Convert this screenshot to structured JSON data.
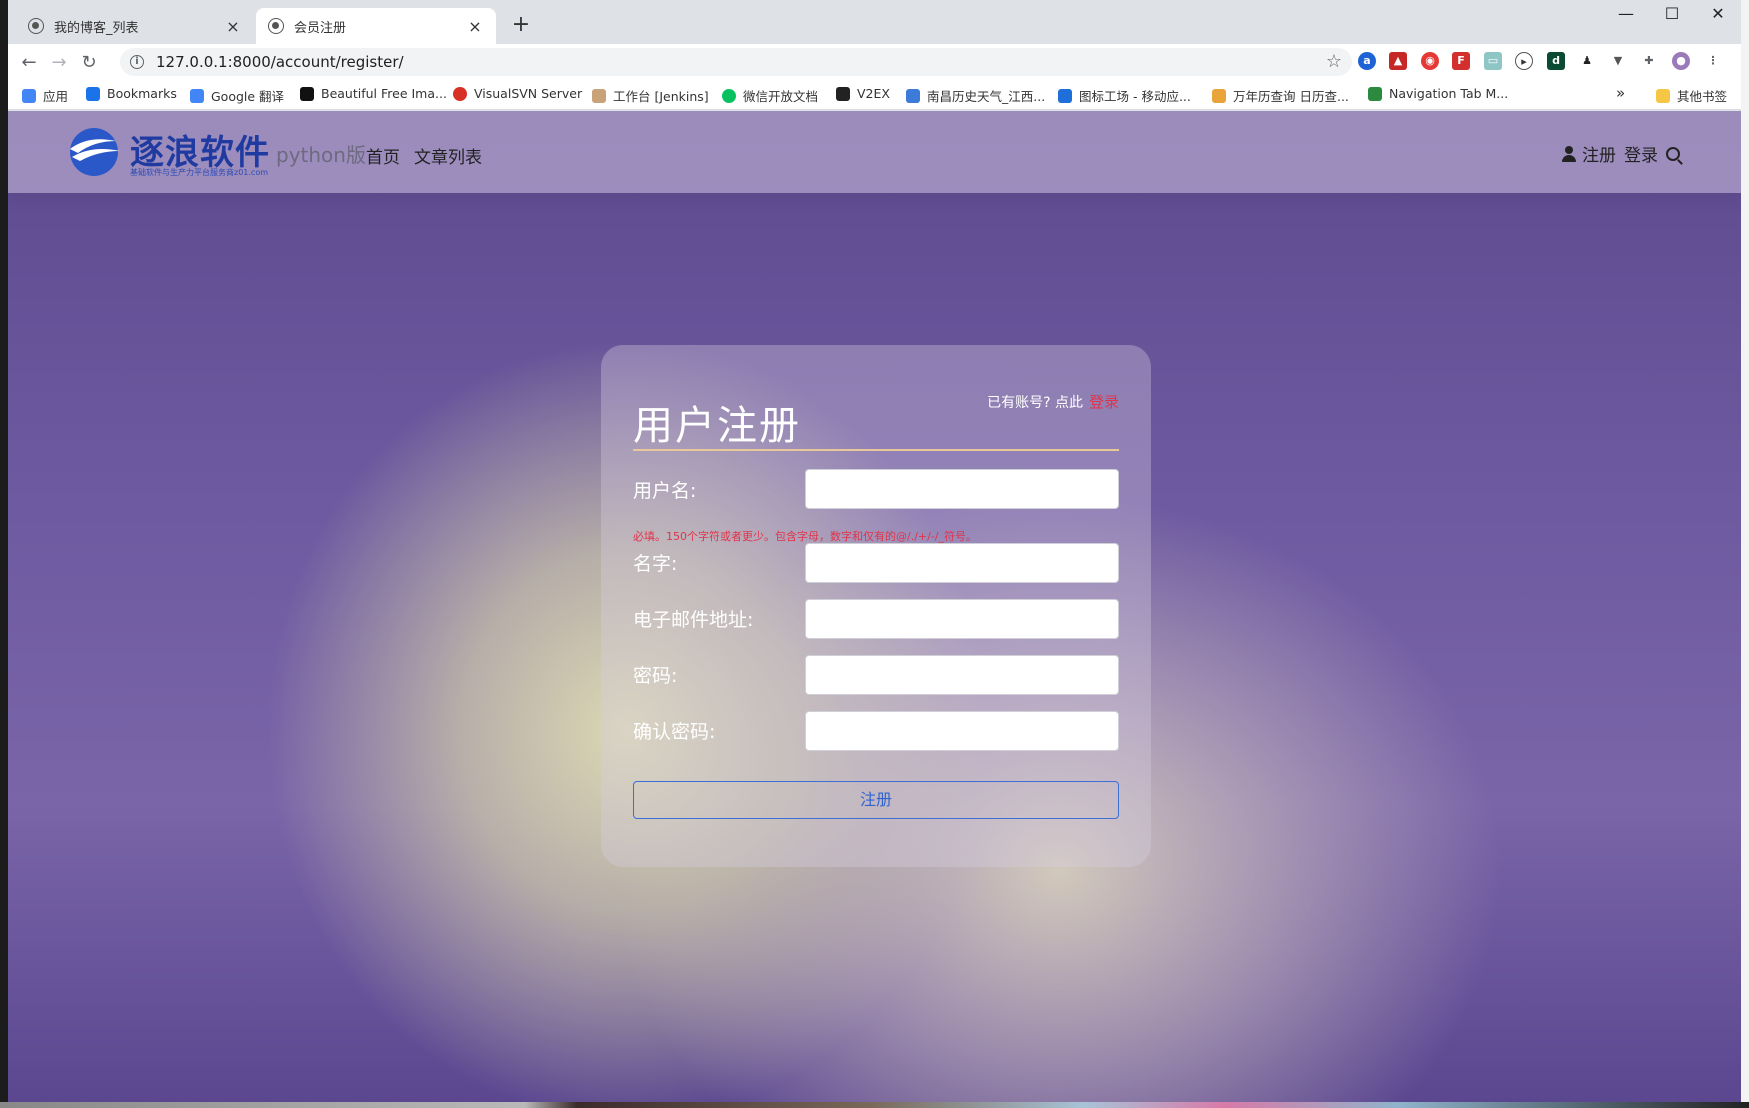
{
  "browser": {
    "tabs": [
      {
        "title": "我的博客_列表",
        "active": false
      },
      {
        "title": "会员注册",
        "active": true
      }
    ],
    "new_tab_symbol": "+",
    "close_symbol": "×",
    "window_controls": {
      "minimize": "—",
      "maximize": "☐",
      "close": "✕"
    },
    "url": "127.0.0.1:8000/account/register/",
    "bookmarks": [
      {
        "label": "应用",
        "icon": "apps-grid-icon",
        "color": "#4285f4"
      },
      {
        "label": "Bookmarks",
        "icon": "star-icon",
        "color": "#1a73e8"
      },
      {
        "label": "Google 翻译",
        "icon": "translate-icon",
        "color": "#4285f4"
      },
      {
        "label": "Beautiful Free Ima...",
        "icon": "camera-icon",
        "color": "#111111"
      },
      {
        "label": "VisualSVN Server",
        "icon": "svn-icon",
        "color": "#d93025"
      },
      {
        "label": "工作台 [Jenkins]",
        "icon": "jenkins-icon",
        "color": "#c9a27a"
      },
      {
        "label": "微信开放文档",
        "icon": "wechat-icon",
        "color": "#07c160"
      },
      {
        "label": "V2EX",
        "icon": "v2ex-icon",
        "color": "#222222"
      },
      {
        "label": "南昌历史天气_江西...",
        "icon": "weather-icon",
        "color": "#3d7bd8"
      },
      {
        "label": "图标工场 - 移动应...",
        "icon": "rh-icon",
        "color": "#1e6fd9"
      },
      {
        "label": "万年历查询 日历查...",
        "icon": "calendar-icon",
        "color": "#e8a33a"
      },
      {
        "label": "Navigation Tab M...",
        "icon": "flag-icon",
        "color": "#2b8a3e"
      }
    ],
    "bookmarks_overflow": "»",
    "other_bookmarks": "其他书签"
  },
  "site": {
    "brand": "逐浪软件",
    "slogan": "基础软件与生产力平台服务商z01.com",
    "edition": "python版",
    "nav": {
      "home": "首页",
      "articles": "文章列表"
    },
    "header_right": {
      "register": "注册",
      "login": "登录"
    },
    "colors": {
      "brand": "#1f3aa0",
      "accent_red": "#e0344b",
      "button_blue": "#2f63d0"
    }
  },
  "form": {
    "title": "用户注册",
    "login_hint": "已有账号? 点此",
    "login_link": "登录",
    "fields": [
      {
        "label": "用户名:",
        "value": ""
      },
      {
        "label": "名字:",
        "value": ""
      },
      {
        "label": "电子邮件地址:",
        "value": ""
      },
      {
        "label": "密码:",
        "value": ""
      },
      {
        "label": "确认密码:",
        "value": ""
      }
    ],
    "username_help": "必填。150个字符或者更少。包含字母，数字和仅有的@/./+/-/_符号。",
    "submit_label": "注册"
  }
}
